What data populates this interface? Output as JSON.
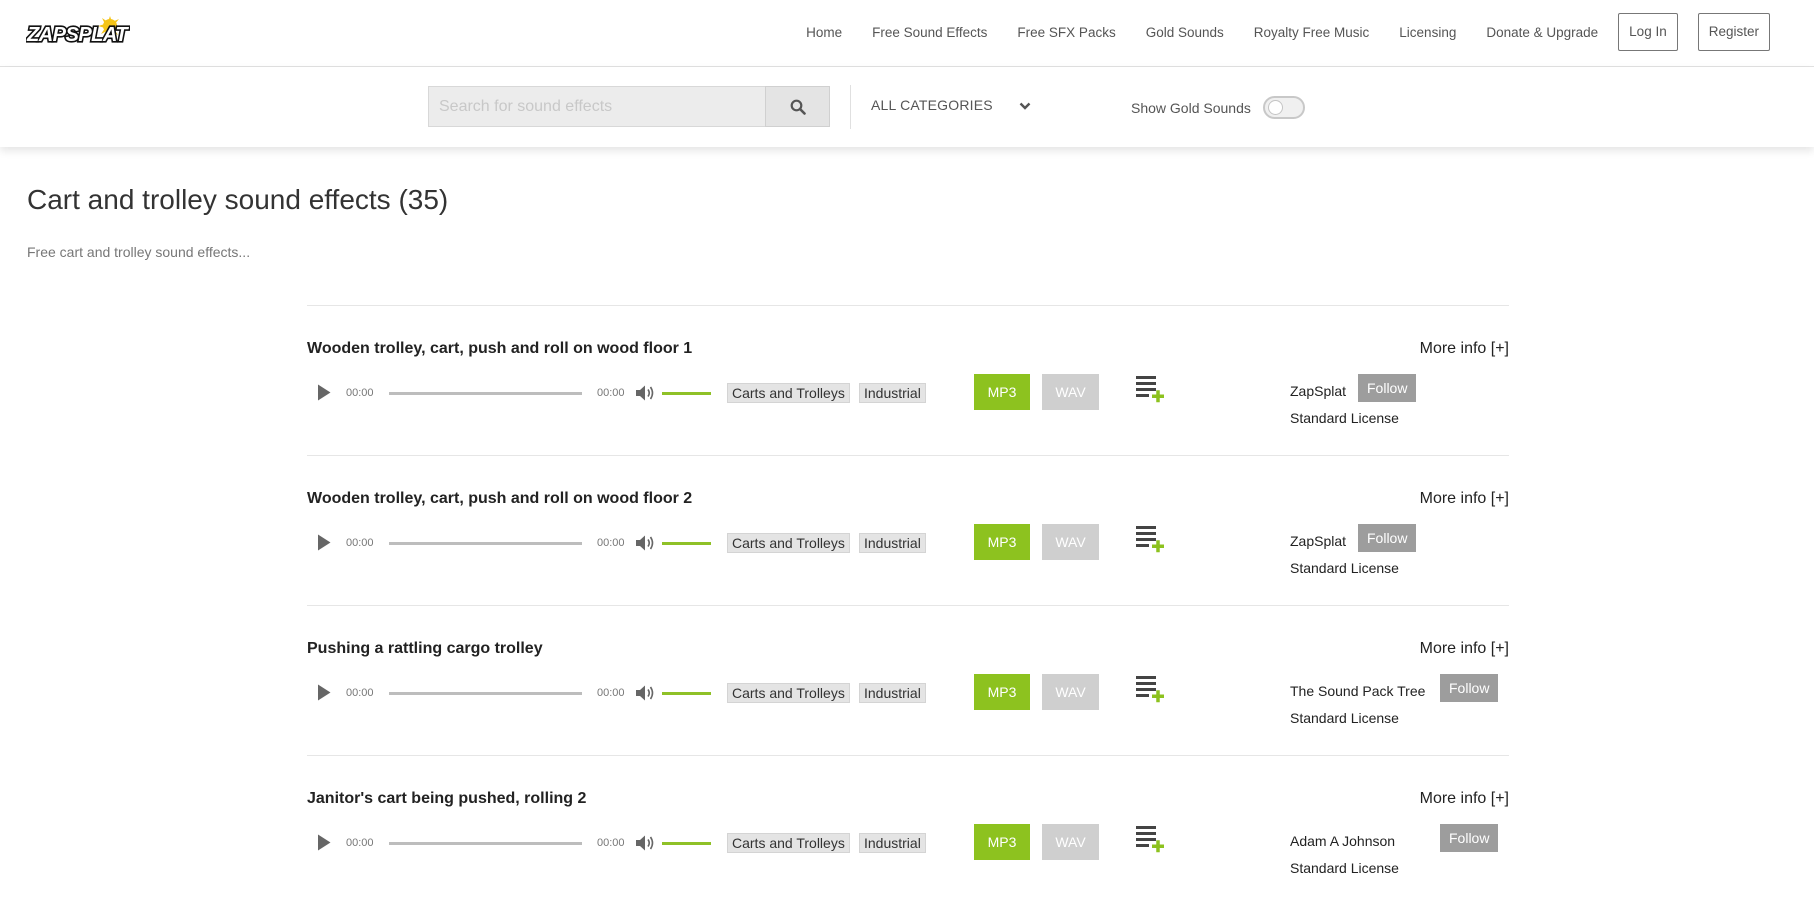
{
  "brand": {
    "logo_text": "ZAPSPLAT",
    "accent": "#8dc21f"
  },
  "nav": {
    "links": [
      "Home",
      "Free Sound Effects",
      "Free SFX Packs",
      "Gold Sounds",
      "Royalty Free Music",
      "Licensing",
      "Donate & Upgrade"
    ],
    "login_label": "Log In",
    "register_label": "Register"
  },
  "search": {
    "placeholder": "Search for sound effects",
    "value": "",
    "icon": "search-icon",
    "category": "ALL CATEGORIES",
    "gold_label": "Show Gold Sounds",
    "gold_enabled": false
  },
  "page": {
    "title": "Cart and trolley sound effects (35)",
    "description": "Free cart and trolley sound effects..."
  },
  "results": [
    {
      "title": "Wooden trolley, cart, push and roll on wood floor 1",
      "more_info": "More info [+]",
      "current_time": "00:00",
      "duration": "00:00",
      "volume": 1.0,
      "tags": [
        "Carts and Trolleys",
        "Industrial"
      ],
      "mp3_label": "MP3",
      "wav_label": "WAV",
      "author": "ZapSplat",
      "follow_label": "Follow",
      "license": "Standard License"
    },
    {
      "title": "Wooden trolley, cart, push and roll on wood floor 2",
      "more_info": "More info [+]",
      "current_time": "00:00",
      "duration": "00:00",
      "volume": 1.0,
      "tags": [
        "Carts and Trolleys",
        "Industrial"
      ],
      "mp3_label": "MP3",
      "wav_label": "WAV",
      "author": "ZapSplat",
      "follow_label": "Follow",
      "license": "Standard License"
    },
    {
      "title": "Pushing a rattling cargo trolley",
      "more_info": "More info [+]",
      "current_time": "00:00",
      "duration": "00:00",
      "volume": 1.0,
      "tags": [
        "Carts and Trolleys",
        "Industrial"
      ],
      "mp3_label": "MP3",
      "wav_label": "WAV",
      "author": "The Sound Pack Tree",
      "follow_label": "Follow",
      "license": "Standard License"
    },
    {
      "title": "Janitor's cart being pushed, rolling 2",
      "more_info": "More info [+]",
      "current_time": "00:00",
      "duration": "00:00",
      "volume": 1.0,
      "tags": [
        "Carts and Trolleys",
        "Industrial"
      ],
      "mp3_label": "MP3",
      "wav_label": "WAV",
      "author": "Adam A Johnson",
      "follow_label": "Follow",
      "license": "Standard License"
    }
  ]
}
